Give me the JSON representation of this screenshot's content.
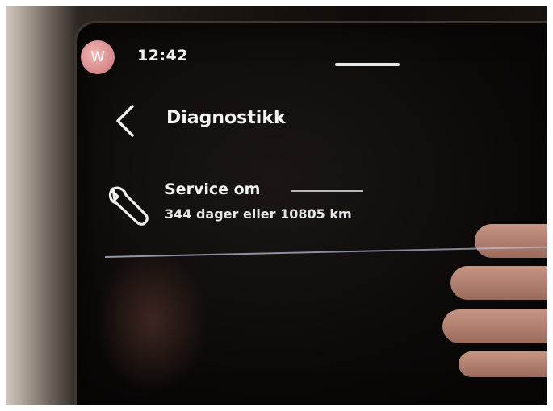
{
  "status_bar": {
    "avatar_letter": "W",
    "time": "12:42"
  },
  "header": {
    "title": "Diagnostikk",
    "back_icon": "chevron-left-icon"
  },
  "service": {
    "icon": "wrench-icon",
    "title": "Service om",
    "detail": "344 dager eller 10805 km"
  },
  "colors": {
    "screen_background": "#0b0908",
    "text": "#f4f4f4",
    "avatar": "#d98a8e",
    "separator": "#b4b9d2"
  }
}
